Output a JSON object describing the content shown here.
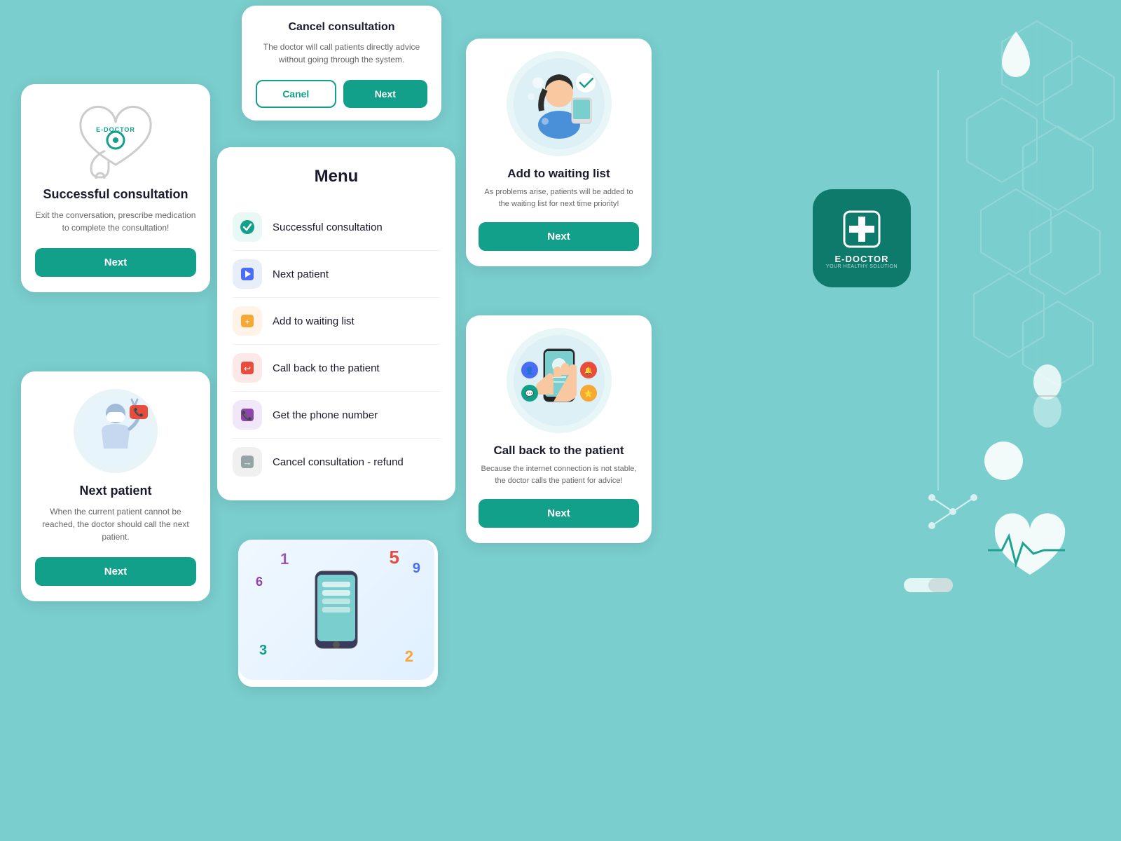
{
  "bg": {
    "color": "#7ecfcf"
  },
  "card_success": {
    "title": "Successful consultation",
    "desc": "Exit the conversation, prescribe medication to complete the consultation!",
    "next_btn": "Next"
  },
  "card_next_patient": {
    "title": "Next patient",
    "desc": "When the current patient cannot be reached, the doctor should call the next patient.",
    "next_btn": "Next"
  },
  "card_cancel": {
    "title": "Cancel consultation",
    "desc": "The doctor will call patients directly advice without going through the system.",
    "cancel_btn": "Canel",
    "next_btn": "Next"
  },
  "card_menu": {
    "title": "Menu",
    "items": [
      {
        "label": "Successful consultation",
        "icon_type": "check",
        "color": "green"
      },
      {
        "label": "Next patient",
        "icon_type": "arrow-right",
        "color": "blue"
      },
      {
        "label": "Add to waiting list",
        "icon_type": "person-add",
        "color": "orange"
      },
      {
        "label": "Call back to the patient",
        "icon_type": "call-back",
        "color": "red"
      },
      {
        "label": "Get the phone number",
        "icon_type": "phone",
        "color": "purple"
      },
      {
        "label": "Cancel consultation - refund",
        "icon_type": "exit",
        "color": "gray"
      }
    ]
  },
  "card_waiting": {
    "title": "Add to waiting list",
    "desc": "As problems arise, patients will be added to the waiting list for next time priority!",
    "next_btn": "Next"
  },
  "card_callback": {
    "title": "Call back to the patient",
    "desc": "Because the internet connection is not stable, the doctor calls the patient for advice!",
    "next_btn": "Next"
  },
  "edoctor_brand": {
    "name": "E-DOCTOR",
    "sub": "YOUR HEALTHY SOLUTION"
  },
  "numbers_card": {
    "numbers": [
      "5",
      "9",
      "2",
      "3",
      "6",
      "1"
    ]
  }
}
